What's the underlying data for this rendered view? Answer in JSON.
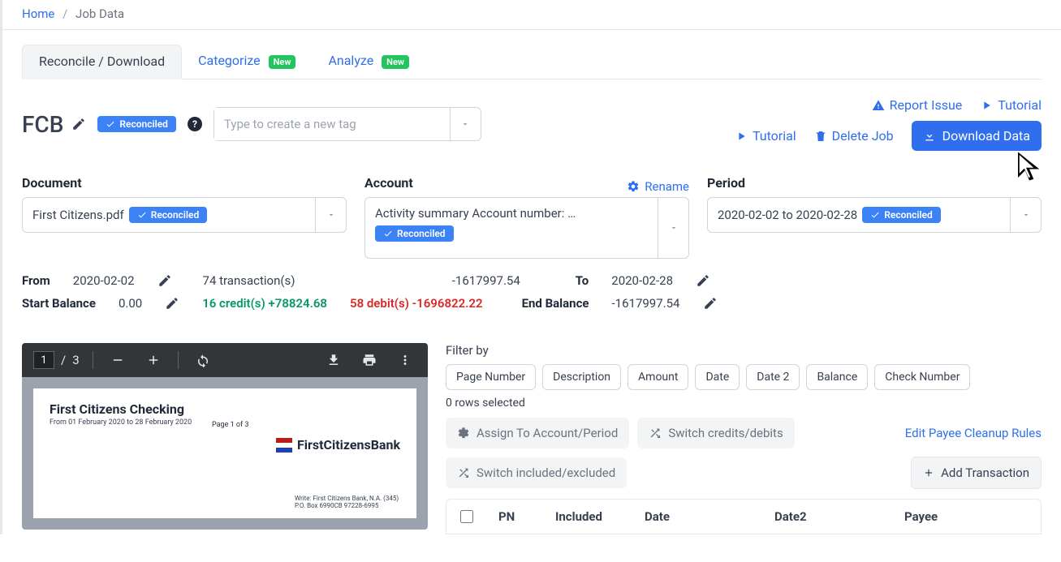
{
  "breadcrumb": {
    "home": "Home",
    "current": "Job Data"
  },
  "tabs": {
    "reconcile": "Reconcile / Download",
    "categorize": "Categorize",
    "analyze": "Analyze",
    "new_badge": "New"
  },
  "job": {
    "title": "FCB",
    "status_badge": "Reconciled",
    "tag_placeholder": "Type to create a new tag"
  },
  "actions": {
    "report_issue": "Report Issue",
    "tutorial": "Tutorial",
    "delete_job": "Delete Job",
    "download_data": "Download Data"
  },
  "document": {
    "label": "Document",
    "value": "First Citizens.pdf",
    "status": "Reconciled"
  },
  "account": {
    "label": "Account",
    "rename": "Rename",
    "value": "Activity summary Account number: …",
    "status": "Reconciled"
  },
  "period": {
    "label": "Period",
    "value": "2020-02-02 to 2020-02-28",
    "status": "Reconciled"
  },
  "stats": {
    "from_label": "From",
    "from": "2020-02-02",
    "to_label": "To",
    "to": "2020-02-28",
    "start_balance_label": "Start Balance",
    "start_balance": "0.00",
    "end_balance_label": "End Balance",
    "end_balance": "-1617997.54",
    "tx_count": "74 transaction(s)",
    "credits": "16 credit(s) +78824.68",
    "debits": "58 debit(s) -1696822.22",
    "net": "-1617997.54"
  },
  "pdf": {
    "page_current": "1",
    "page_total": "3",
    "doc_title": "First Citizens Checking",
    "doc_period": "From 01 February 2020 to 28 February 2020",
    "page_label": "Page 1 of 3",
    "bank_name": "FirstCitizensBank",
    "fine1": "Write: First Citizens Bank, N.A. (345)",
    "fine2": "P.O. Box 6990CB 97228-6995"
  },
  "filters": {
    "label": "Filter by",
    "items": [
      "Page Number",
      "Description",
      "Amount",
      "Date",
      "Date 2",
      "Balance",
      "Check Number"
    ],
    "rows_selected": "0 rows selected"
  },
  "table_actions": {
    "assign": "Assign To Account/Period",
    "switch_cd": "Switch credits/debits",
    "switch_ie": "Switch included/excluded",
    "edit_payee": "Edit Payee Cleanup Rules",
    "add_tx": "Add Transaction"
  },
  "table_headers": [
    "PN",
    "Included",
    "Date",
    "Date2",
    "Payee"
  ]
}
